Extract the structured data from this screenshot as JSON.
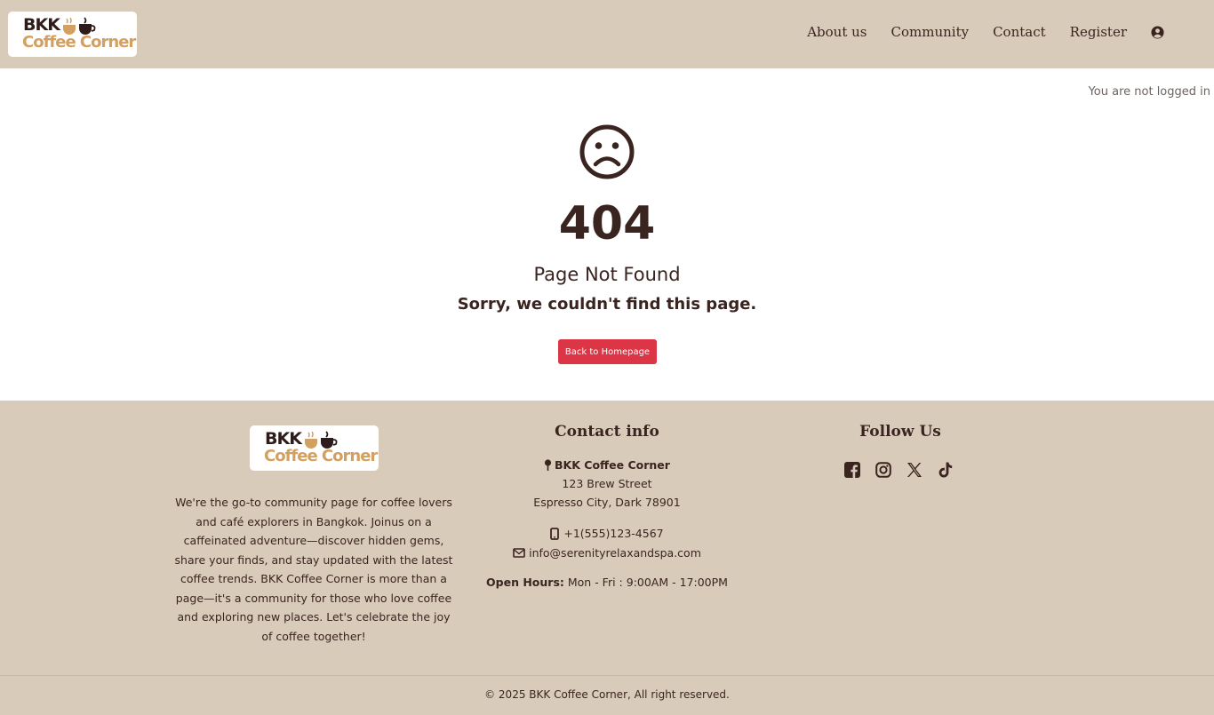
{
  "brand": {
    "line1": "BKK",
    "line2": "Coffee Corner"
  },
  "nav": {
    "items": [
      {
        "label": "About us"
      },
      {
        "label": "Community"
      },
      {
        "label": "Contact"
      },
      {
        "label": "Register"
      }
    ],
    "user_icon": "user-circle-icon"
  },
  "login_status": "You are not logged in",
  "error": {
    "icon": "sad-face-icon",
    "code": "404",
    "title": "Page Not Found",
    "message": "Sorry, we couldn't find this page.",
    "button_label": "Back to Homepage"
  },
  "footer": {
    "about_text": "We're the go-to community page for coffee lovers and café explorers in Bangkok. Joinus on a caffeinated adventure—discover hidden gems, share your finds, and stay updated with the latest coffee trends. BKK Coffee Corner is more than a page—it's a community for those who love coffee and exploring new places. Let's celebrate the joy of coffee together!",
    "contact": {
      "heading": "Contact info",
      "name": "BKK Coffee Corner",
      "street": "123 Brew Street",
      "city": "Espresso City, Dark 78901",
      "phone": "+1(555)123-4567",
      "email": "info@serenityrelaxandspa.com",
      "hours_label": "Open Hours:",
      "hours_value": "Mon - Fri : 9:00AM - 17:00PM"
    },
    "follow": {
      "heading": "Follow Us",
      "icons": [
        "facebook-icon",
        "instagram-icon",
        "x-twitter-icon",
        "tiktok-icon"
      ]
    },
    "copyright": "© 2025 BKK Coffee Corner, All right reserved."
  },
  "colors": {
    "beige": "#d9cbb9",
    "brown_text": "#3a2420",
    "logo_gold": "#d4a061",
    "button_red": "#dc3545"
  }
}
